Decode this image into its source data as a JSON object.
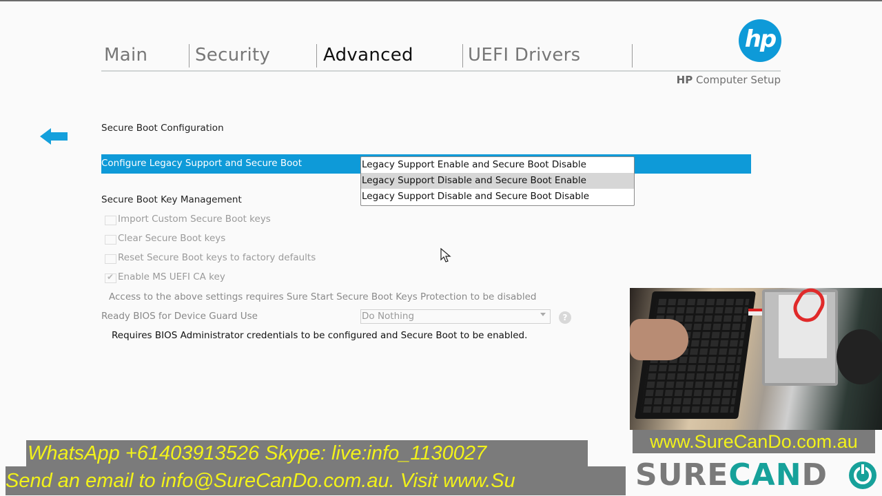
{
  "app": {
    "title": "HP Computer Setup",
    "brand_bold": "HP",
    "brand_rest": " Computer Setup",
    "logo_text": "hp",
    "accent_color": "#0e9ad8"
  },
  "tabs": [
    {
      "label": "Main",
      "active": false
    },
    {
      "label": "Security",
      "active": false
    },
    {
      "label": "Advanced",
      "active": true
    },
    {
      "label": "UEFI Drivers",
      "active": false
    }
  ],
  "secure_boot_config": {
    "heading": "Secure Boot Configuration",
    "setting_label": "Configure Legacy Support and Secure Boot",
    "dropdown": {
      "options": [
        "Legacy Support Enable and Secure Boot Disable",
        "Legacy Support Disable and Secure Boot Enable",
        "Legacy Support Disable and Secure Boot Disable"
      ],
      "hovered_index": 1
    }
  },
  "key_management": {
    "heading": "Secure Boot Key Management",
    "checkboxes": [
      {
        "label": "Import Custom Secure Boot keys",
        "checked": false,
        "disabled": true
      },
      {
        "label": "Clear Secure Boot keys",
        "checked": false,
        "disabled": true
      },
      {
        "label": "Reset Secure Boot keys to factory defaults",
        "checked": false,
        "disabled": true
      },
      {
        "label": "Enable MS UEFI CA key",
        "checked": true,
        "disabled": true
      }
    ],
    "note": "Access to the above settings requires Sure Start Secure Boot Keys Protection to be disabled"
  },
  "device_guard": {
    "label": "Ready BIOS for Device Guard Use",
    "selected": "Do Nothing",
    "help_icon": "?",
    "requirement": "Requires BIOS Administrator credentials to be configured and Secure Boot to be enabled."
  },
  "overlay": {
    "ticker_line1": "WhatsApp +61403913526 Skype: live:info_1130027",
    "ticker_line2": "Send an email to info@SureCanDo.com.au. Visit www.Su",
    "site": "www.SureCanDo.com.au",
    "brand_sure": "SURE",
    "brand_can": "CAN",
    "brand_d": "D"
  }
}
